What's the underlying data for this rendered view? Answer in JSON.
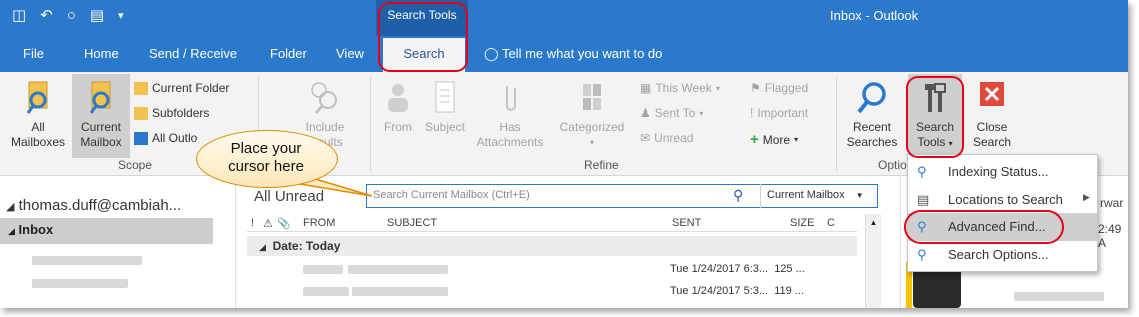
{
  "window": {
    "context_tab_group": "Search Tools",
    "title": "Inbox - Outlook"
  },
  "quick_access": [
    "save-icon",
    "undo-icon",
    "circle-icon",
    "layout-icon",
    "customize-icon"
  ],
  "tabs": {
    "file": "File",
    "home": "Home",
    "send_receive": "Send / Receive",
    "folder": "Folder",
    "view": "View",
    "search": "Search",
    "tell_me": "Tell me what you want to do"
  },
  "ribbon": {
    "scope": {
      "label": "Scope",
      "all_mailboxes": [
        "All",
        "Mailboxes"
      ],
      "current_mailbox": [
        "Current",
        "Mailbox"
      ],
      "current_folder": "Current Folder",
      "subfolders": "Subfolders",
      "all_outlook": "All Outlo"
    },
    "include": [
      "Include",
      "results"
    ],
    "refine": {
      "label": "Refine",
      "from": "From",
      "subject": "Subject",
      "has_attachments": [
        "Has",
        "Attachments"
      ],
      "categorized": "Categorized",
      "this_week": "This Week",
      "sent_to": "Sent To",
      "unread": "Unread",
      "flagged": "Flagged",
      "important": "Important",
      "more": "More"
    },
    "options": {
      "label": "Optio",
      "recent_searches": [
        "Recent",
        "Searches"
      ],
      "search_tools": [
        "Search",
        "Tools"
      ],
      "close_search": [
        "Close",
        "Search"
      ]
    }
  },
  "menu": {
    "items": [
      {
        "label": "Indexing Status...",
        "icon": "indexing-icon"
      },
      {
        "label": "Locations to Search",
        "icon": "locations-icon"
      },
      {
        "label": "Advanced Find...",
        "icon": "advanced-find-icon"
      },
      {
        "label": "Search Options...",
        "icon": "search-options-icon"
      }
    ]
  },
  "callout": [
    "Place your",
    "cursor here"
  ],
  "left_pane": {
    "account": "thomas.duff@cambiah...",
    "inbox": "Inbox"
  },
  "message_list": {
    "filter_all": "All",
    "filter_unread": "Unread",
    "search_placeholder": "Search Current Mailbox (Ctrl+E)",
    "scope_dropdown": "Current Mailbox",
    "columns": [
      "FROM",
      "SUBJECT",
      "SENT",
      "SIZE",
      "C"
    ],
    "group": "Date: Today",
    "rows": [
      {
        "sent": "Tue 1/24/2017 6:3...",
        "size": "125 ..."
      },
      {
        "sent": "Tue 1/24/2017 5:3...",
        "size": "119 ..."
      }
    ]
  },
  "reading_pane": {
    "snippet_1": "rwar",
    "snippet_2": "2:49 A"
  },
  "colors": {
    "title_blue": "#2b79cb",
    "ribbon_bg": "#f3f3f3",
    "highlight_red": "#e3001b",
    "close_red": "#e04a3a"
  }
}
